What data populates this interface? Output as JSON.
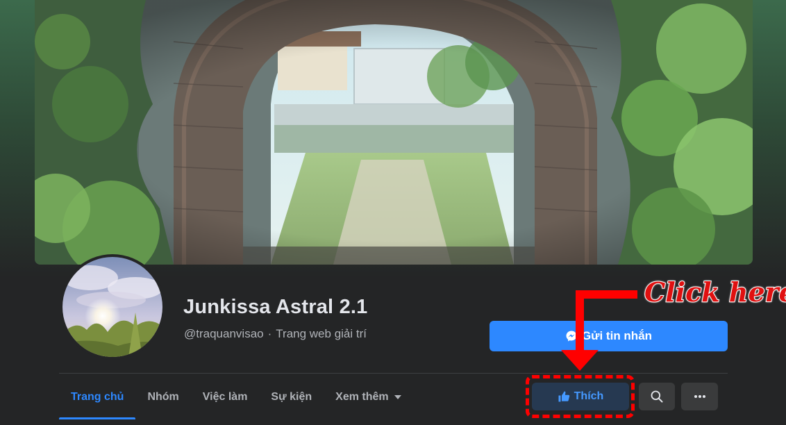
{
  "page": {
    "title": "Junkissa Astral 2.1",
    "handle": "@traquanvisao",
    "separator": "·",
    "category": "Trang web giải trí"
  },
  "actions": {
    "message_label": "Gửi tin nhắn",
    "like_label": "Thích"
  },
  "tabs": [
    {
      "label": "Trang chủ",
      "active": true
    },
    {
      "label": "Nhóm",
      "active": false
    },
    {
      "label": "Việc làm",
      "active": false
    },
    {
      "label": "Sự kiện",
      "active": false
    },
    {
      "label": "Xem thêm",
      "active": false
    }
  ],
  "annotation": {
    "text": "Click here"
  },
  "icons": {
    "message": "messenger-icon",
    "like": "thumbs-up-icon",
    "search": "search-icon",
    "more": "more-dots-icon",
    "dropdown": "caret-down-icon"
  },
  "colors": {
    "accent": "#2d88ff",
    "background": "#242526",
    "annotation": "#ff0000"
  }
}
